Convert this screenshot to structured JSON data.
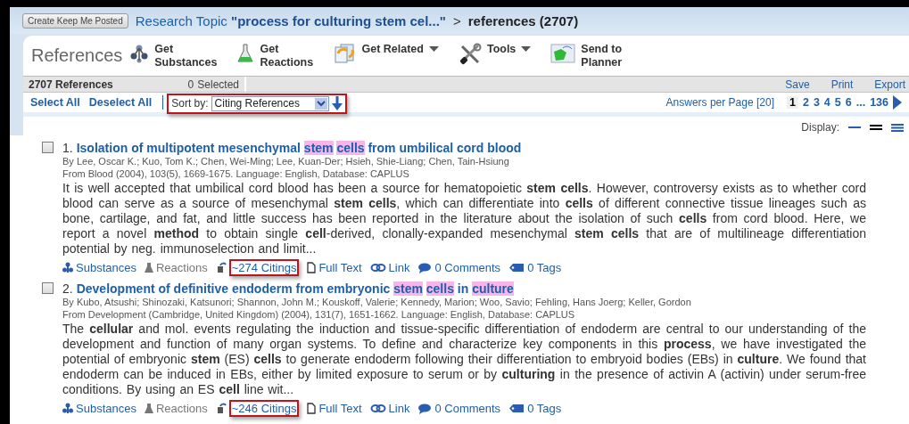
{
  "breadcrumb": {
    "button": "Create Keep Me Posted",
    "topic_link": "Research Topic **\"process for culturing stem cel...\"**",
    "separator": ">",
    "current": "references (2707)"
  },
  "toolbar": {
    "title": "References",
    "items": [
      {
        "kind": "substances",
        "label": "Get Substances",
        "dropdown": false
      },
      {
        "kind": "reactions",
        "label": "Get Reactions",
        "dropdown": false
      },
      {
        "kind": "related",
        "label": "Get Related",
        "dropdown": true
      },
      {
        "kind": "tools",
        "label": "Tools",
        "dropdown": true
      },
      {
        "kind": "planner",
        "label": "Send to Planner",
        "dropdown": false
      }
    ]
  },
  "summary": {
    "count": "2707 References",
    "selected_count": "0",
    "selected_label": "Selected",
    "actions": [
      "Save",
      "Print",
      "Export"
    ]
  },
  "controls": {
    "select_all": "Select All",
    "deselect_all": "Deselect All",
    "sort": {
      "label": "Sort by:",
      "value": "Citing References",
      "highlighted": true
    },
    "answers_per_page": "Answers per Page [20]",
    "pages": [
      {
        "label": "1",
        "selected": true
      },
      {
        "label": "2",
        "selected": false
      },
      {
        "label": "3",
        "selected": false
      },
      {
        "label": "4",
        "selected": false
      },
      {
        "label": "5",
        "selected": false
      },
      {
        "label": "6",
        "selected": false
      },
      {
        "label": "...",
        "selected": false
      },
      {
        "label": "136",
        "selected": false
      }
    ]
  },
  "display": {
    "label": "Display:",
    "options": [
      {
        "kind": "single",
        "selected": false
      },
      {
        "kind": "double",
        "selected": true
      },
      {
        "kind": "triple",
        "selected": false
      }
    ]
  },
  "records": [
    {
      "checked": false,
      "number": "1.",
      "title_parts": [
        {
          "text": "Isolation of multipotent mesenchymal",
          "highlighted": false
        },
        {
          "text": "stem",
          "highlighted": true
        },
        {
          "text": "cells",
          "highlighted": true
        },
        {
          "text": "from umbilical cord blood",
          "highlighted": false
        }
      ],
      "authors": "By Lee, Oscar K.; Kuo, Tom K.; Chen, Wei-Ming; Lee, Kuan-Der; Hsieh, Shie-Liang; Chen, Tain-Hsiung",
      "source": "From Blood (2004), 103(5), 1669-1675. Language: English, Database: CAPLUS",
      "abstract": "It is well accepted that umbilical cord blood has been a source for hematopoietic **stem cells**.  However, controversy exists as to whether cord blood can serve as a source of mesenchymal **stem cells**, which can differentiate into **cells** of different connective tissue lineages such as bone, cartilage, and fat, and little success has been reported in the literature about the isolation of such **cells** from cord blood.  Here, we report a novel **method** to obtain single **cell**-derived, clonally-expanded mesenchymal **stem cells** that are of multilineage differentiation potential by neg. immunoselection and limit...",
      "links": [
        {
          "kind": "substances",
          "label": "Substances",
          "disabled": false,
          "highlighted": false
        },
        {
          "kind": "reactions",
          "label": "Reactions",
          "disabled": true,
          "highlighted": false
        },
        {
          "kind": "citings",
          "label": "~274 Citings",
          "disabled": false,
          "highlighted": true
        },
        {
          "kind": "fulltext",
          "label": "Full Text",
          "disabled": false,
          "highlighted": false
        },
        {
          "kind": "link",
          "label": "Link",
          "disabled": false,
          "highlighted": false
        },
        {
          "kind": "comments",
          "label": "0 Comments",
          "disabled": false,
          "highlighted": false
        },
        {
          "kind": "tags",
          "label": "0 Tags",
          "disabled": false,
          "highlighted": false
        }
      ]
    },
    {
      "checked": false,
      "number": "2.",
      "title_parts": [
        {
          "text": "Development of definitive endoderm from embryonic",
          "highlighted": false
        },
        {
          "text": "stem",
          "highlighted": true
        },
        {
          "text": "cells",
          "highlighted": true
        },
        {
          "text": "in",
          "highlighted": false
        },
        {
          "text": "culture",
          "highlighted": true
        }
      ],
      "authors": "By Kubo, Atsushi; Shinozaki, Katsunori; Shannon, John M.; Kouskoff, Valerie; Kennedy, Marion; Woo, Savio; Fehling, Hans Joerg; Keller, Gordon",
      "source": "From Development (Cambridge, United Kingdom) (2004), 131(7), 1651-1662. Language: English, Database: CAPLUS",
      "abstract": "The **cellular** and mol. events regulating the induction and tissue-specific differentiation of endoderm are central to our understanding of the development and function of many organ systems.  To define and characterize key components in this **process**, we have investigated the potential of embryonic **stem** (ES) **cells** to generate endoderm following their differentiation to embryoid bodies (EBs) in **culture**.  We found that endoderm can be induced in EBs, either by limited exposure to serum or by **culturing** in the presence of activin A (activin) under serum-free conditions.  By using an ES **cell** line wit...",
      "links": [
        {
          "kind": "substances",
          "label": "Substances",
          "disabled": false,
          "highlighted": false
        },
        {
          "kind": "reactions",
          "label": "Reactions",
          "disabled": true,
          "highlighted": false
        },
        {
          "kind": "citings",
          "label": "~246 Citings",
          "disabled": false,
          "highlighted": true
        },
        {
          "kind": "fulltext",
          "label": "Full Text",
          "disabled": false,
          "highlighted": false
        },
        {
          "kind": "link",
          "label": "Link",
          "disabled": false,
          "highlighted": false
        },
        {
          "kind": "comments",
          "label": "0 Comments",
          "disabled": false,
          "highlighted": false
        },
        {
          "kind": "tags",
          "label": "0 Tags",
          "disabled": false,
          "highlighted": false
        }
      ]
    }
  ]
}
